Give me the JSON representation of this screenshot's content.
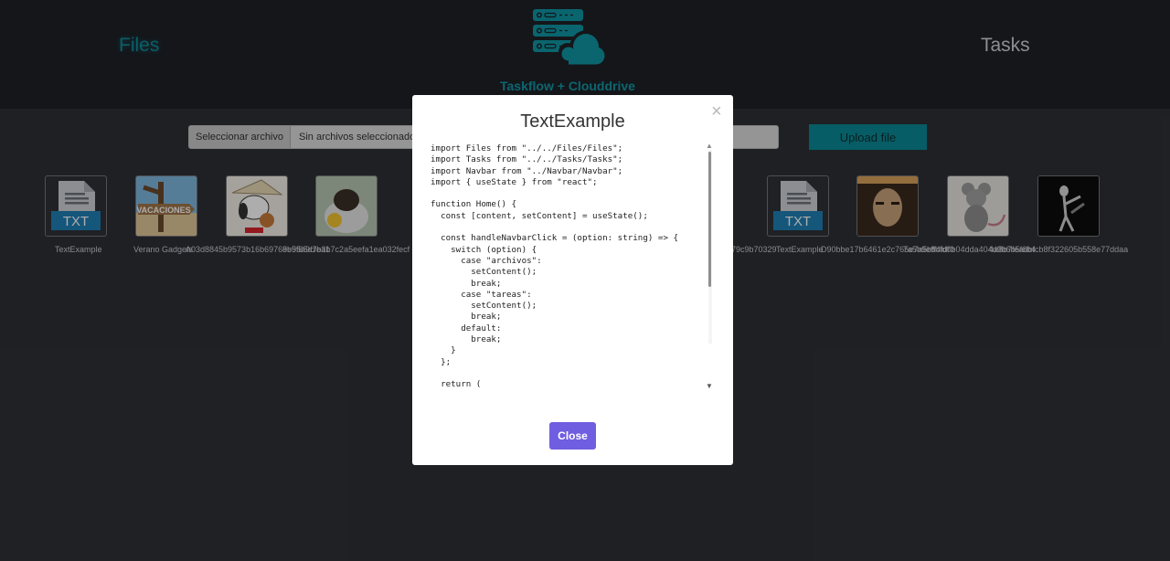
{
  "navbar": {
    "files_label": "Files",
    "tasks_label": "Tasks",
    "brand": "Taskflow + Clouddrive"
  },
  "upload": {
    "choose_label": "Seleccionar archivo",
    "status_text": "Sin archivos seleccionados",
    "button_label": "Upload file"
  },
  "files": [
    {
      "caption": "TextExample",
      "icon": "txt-file-icon"
    },
    {
      "caption": "Verano Gadgets",
      "icon": "image-thumbnail"
    },
    {
      "caption": "A03d8845b9573b16b69769e95a9cfea1",
      "icon": "image-thumbnail"
    },
    {
      "caption": "8b5f85d7b3b7c2a5eefa1ea032fecf",
      "icon": "image-thumbnail"
    },
    {
      "caption": "79c9b70329",
      "icon": "image-thumbnail"
    },
    {
      "caption": "TextExample",
      "icon": "txt-file-icon"
    },
    {
      "caption": "D90bbe17b6461e2c765e7a5bff4fdf0",
      "icon": "image-thumbnail"
    },
    {
      "caption": "7a5b9e8bfd0b04dda404d9b6b5f6b4",
      "icon": "image-thumbnail"
    },
    {
      "caption": "4a8b7feadbfcb8f322605b558e77ddaa",
      "icon": "image-thumbnail"
    }
  ],
  "txt_badge": "TXT",
  "thumb_texts": {
    "vacaciones": "VACACIONES"
  },
  "modal": {
    "title": "TextExample",
    "close_x": "×",
    "close_label": "Close",
    "code": "import Files from \"../../Files/Files\";\nimport Tasks from \"../../Tasks/Tasks\";\nimport Navbar from \"../Navbar/Navbar\";\nimport { useState } from \"react\";\n\nfunction Home() {\n  const [content, setContent] = useState();\n\n  const handleNavbarClick = (option: string) => {\n    switch (option) {\n      case \"archivos\":\n        setContent();\n        break;\n      case \"tareas\":\n        setContent();\n        break;\n      default:\n        break;\n    }\n  };\n\n  return ("
  },
  "colors": {
    "background": "#2d3036",
    "navbar": "#1e2127",
    "accent": "#0b8a95",
    "close_button": "#6f5ee0"
  }
}
